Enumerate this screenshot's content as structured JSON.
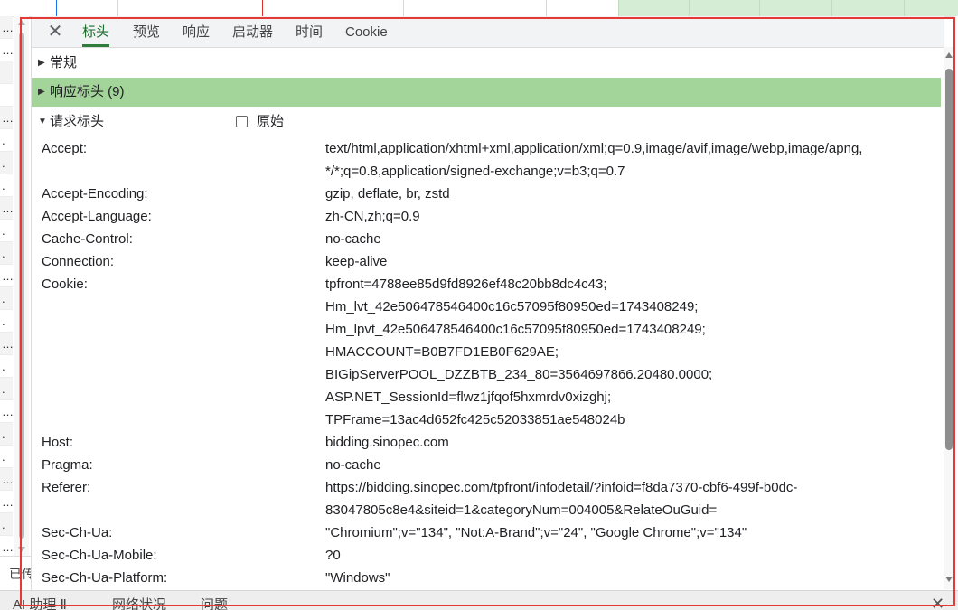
{
  "colors": {
    "accent_tab": "#2f7d3a",
    "section_highlight": "#a3d59a",
    "waterfall_green": "#d5ecd5",
    "waterfall_blue_line": "#1a73e8",
    "waterfall_red_line": "#d93025",
    "annotation_red": "#e53935"
  },
  "left_list": {
    "rows": [
      "…",
      "…",
      "",
      "",
      "…",
      ".",
      ".",
      ".",
      "…",
      ".",
      ".",
      "…",
      ".",
      ".",
      "…",
      ".",
      ".",
      "…",
      ".",
      ".",
      "…",
      "…",
      ".",
      "…"
    ],
    "status_text": "已传"
  },
  "tabs": {
    "close_icon": "✕",
    "items": [
      {
        "label": "标头",
        "active": true
      },
      {
        "label": "预览",
        "active": false
      },
      {
        "label": "响应",
        "active": false
      },
      {
        "label": "启动器",
        "active": false
      },
      {
        "label": "时间",
        "active": false
      },
      {
        "label": "Cookie",
        "active": false
      }
    ]
  },
  "sections": {
    "general": {
      "label": "常规",
      "expanded": false,
      "icon": "triangle-right-icon"
    },
    "response_headers": {
      "label": "响应标头 (9)",
      "expanded": false,
      "icon": "triangle-right-icon"
    },
    "request_headers": {
      "label": "请求标头",
      "expanded": true,
      "icon": "triangle-down-icon",
      "raw_label": "原始",
      "raw_checked": false
    }
  },
  "request_headers": [
    {
      "name": "Accept:",
      "value": [
        "text/html,application/xhtml+xml,application/xml;q=0.9,image/avif,image/webp,image/apng,",
        "*/*;q=0.8,application/signed-exchange;v=b3;q=0.7"
      ]
    },
    {
      "name": "Accept-Encoding:",
      "value": [
        "gzip, deflate, br, zstd"
      ]
    },
    {
      "name": "Accept-Language:",
      "value": [
        "zh-CN,zh;q=0.9"
      ]
    },
    {
      "name": "Cache-Control:",
      "value": [
        "no-cache"
      ]
    },
    {
      "name": "Connection:",
      "value": [
        "keep-alive"
      ]
    },
    {
      "name": "Cookie:",
      "value": [
        "tpfront=4788ee85d9fd8926ef48c20bb8dc4c43;",
        "Hm_lvt_42e506478546400c16c57095f80950ed=1743408249;",
        "Hm_lpvt_42e506478546400c16c57095f80950ed=1743408249;",
        "HMACCOUNT=B0B7FD1EB0F629AE;",
        "BIGipServerPOOL_DZZBTB_234_80=3564697866.20480.0000;",
        "ASP.NET_SessionId=flwz1jfqof5hxmrdv0xizghj;",
        "TPFrame=13ac4d652fc425c52033851ae548024b"
      ]
    },
    {
      "name": "Host:",
      "value": [
        "bidding.sinopec.com"
      ]
    },
    {
      "name": "Pragma:",
      "value": [
        "no-cache"
      ]
    },
    {
      "name": "Referer:",
      "value": [
        "https://bidding.sinopec.com/tpfront/infodetail/?infoid=f8da7370-cbf6-499f-b0dc-",
        "83047805c8e4&siteid=1&categoryNum=004005&RelateOuGuid="
      ]
    },
    {
      "name": "Sec-Ch-Ua:",
      "value": [
        "\"Chromium\";v=\"134\", \"Not:A-Brand\";v=\"24\", \"Google Chrome\";v=\"134\""
      ]
    },
    {
      "name": "Sec-Ch-Ua-Mobile:",
      "value": [
        "?0"
      ]
    },
    {
      "name": "Sec-Ch-Ua-Platform:",
      "value": [
        "\"Windows\""
      ]
    }
  ],
  "bottom_bar": {
    "tabs": [
      "AI 助理 Ⅱ",
      "网络状况",
      "问题"
    ],
    "close_icon": "✕"
  }
}
